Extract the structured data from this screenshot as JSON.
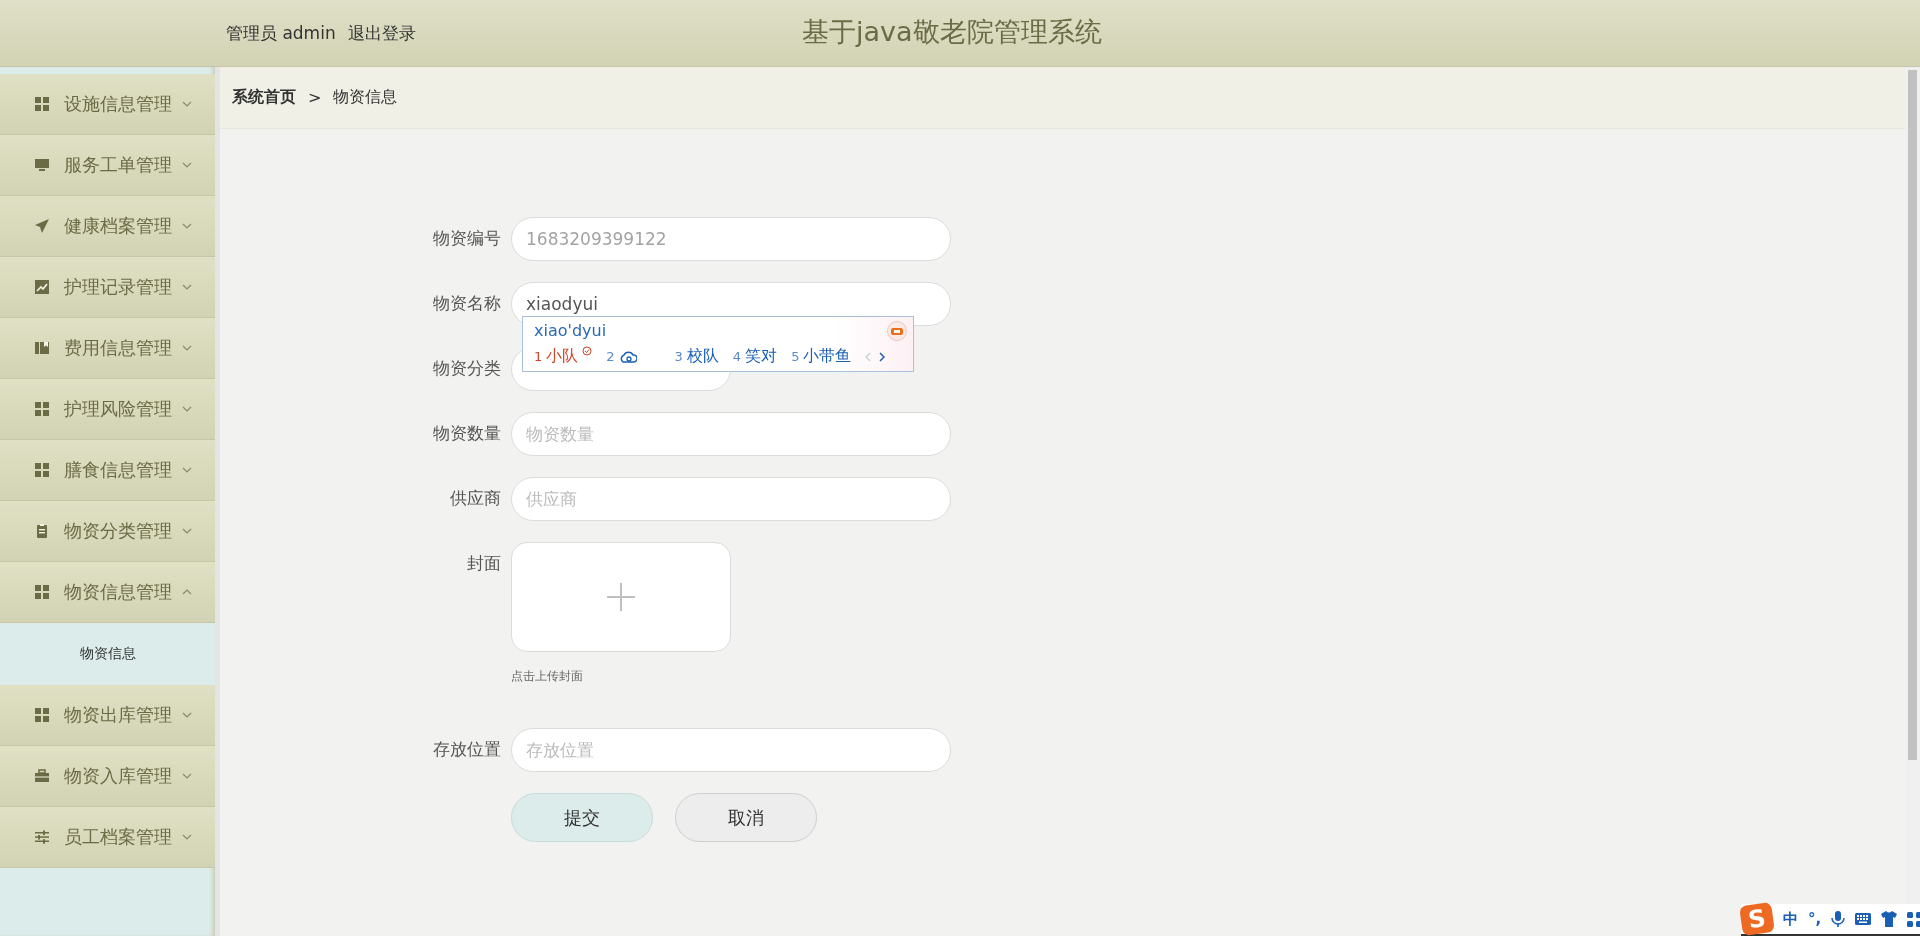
{
  "header": {
    "user_label": "管理员 admin",
    "logout": "退出登录",
    "title": "基于java敬老院管理系统"
  },
  "sidebar": {
    "items": [
      {
        "label": "设施信息管理",
        "expanded": false
      },
      {
        "label": "服务工单管理",
        "expanded": false
      },
      {
        "label": "健康档案管理",
        "expanded": false
      },
      {
        "label": "护理记录管理",
        "expanded": false
      },
      {
        "label": "费用信息管理",
        "expanded": false
      },
      {
        "label": "护理风险管理",
        "expanded": false
      },
      {
        "label": "膳食信息管理",
        "expanded": false
      },
      {
        "label": "物资分类管理",
        "expanded": false
      },
      {
        "label": "物资信息管理",
        "expanded": true,
        "children": [
          {
            "label": "物资信息",
            "selected": true
          }
        ]
      },
      {
        "label": "物资出库管理",
        "expanded": false
      },
      {
        "label": "物资入库管理",
        "expanded": false
      },
      {
        "label": "员工档案管理",
        "expanded": false
      }
    ]
  },
  "breadcrumb": {
    "home": "系统首页",
    "separator": ">",
    "current": "物资信息"
  },
  "form": {
    "fields": [
      {
        "kind": "input",
        "label": "物资编号",
        "value": "1683209399122",
        "disabled": true
      },
      {
        "kind": "input",
        "label": "物资名称",
        "value": "xiaodyui",
        "disabled": false
      },
      {
        "kind": "select",
        "label": "物资分类"
      },
      {
        "kind": "input",
        "label": "物资数量",
        "placeholder": "物资数量",
        "disabled": false
      },
      {
        "kind": "input",
        "label": "供应商",
        "placeholder": "供应商",
        "disabled": false
      },
      {
        "kind": "upload",
        "label": "封面",
        "hint": "点击上传封面"
      },
      {
        "kind": "input",
        "label": "存放位置",
        "placeholder": "存放位置",
        "disabled": false
      }
    ],
    "buttons": [
      {
        "label": "提交",
        "kind": "primary"
      },
      {
        "label": "取消",
        "kind": "default"
      }
    ]
  },
  "ime_popup": {
    "composition": "xiao'dyui",
    "candidates": [
      {
        "kind": "word",
        "number": "1",
        "text": "小队",
        "selected": true
      },
      {
        "kind": "cloud",
        "number": "2",
        "selected": false
      },
      {
        "kind": "word",
        "number": "3",
        "text": "校队",
        "selected": false
      },
      {
        "kind": "word",
        "number": "4",
        "text": "笑对",
        "selected": false
      },
      {
        "kind": "word",
        "number": "5",
        "text": "小带鱼",
        "selected": false
      }
    ]
  },
  "ime_toolbar": {
    "logo": "S",
    "mode": "中",
    "punctuation": "°,"
  }
}
